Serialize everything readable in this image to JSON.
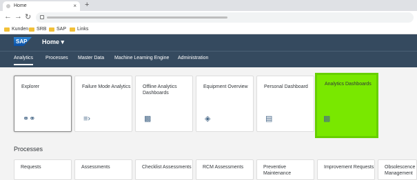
{
  "browser": {
    "tab_title": "Home",
    "close_glyph": "×",
    "newtab_glyph": "+",
    "back_glyph": "←",
    "forward_glyph": "→",
    "reload_glyph": "↻",
    "bookmarks": [
      "Kunden",
      "SRB",
      "SAP",
      "Links"
    ]
  },
  "shell": {
    "logo_text": "SAP",
    "title": "Home ▾",
    "nav": [
      "Analytics",
      "Processes",
      "Master Data",
      "Machine Learning Engine",
      "Administration"
    ]
  },
  "tiles": [
    {
      "label": "Explorer",
      "icon": "binoculars-icon"
    },
    {
      "label": "Failure Mode Analytics",
      "icon": "flow-icon"
    },
    {
      "label": "Offline Analytics Dashboards",
      "icon": "dashboard-icon"
    },
    {
      "label": "Equipment Overview",
      "icon": "equipment-icon"
    },
    {
      "label": "Personal Dashboard",
      "icon": "document-icon"
    },
    {
      "label": "Analytics Dashboards",
      "icon": "dashboard-icon"
    }
  ],
  "processes": {
    "title": "Processes",
    "tiles": [
      "Requests",
      "Assessments",
      "Checklist Assessments",
      "RCM Assessments",
      "Preventive Maintenance",
      "Improvement Requests",
      "Obsolescence Management"
    ]
  },
  "colors": {
    "shell": "#354a5f",
    "highlight": "#79e800"
  }
}
